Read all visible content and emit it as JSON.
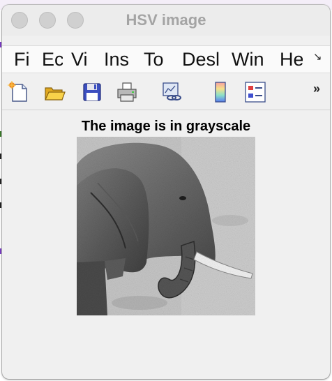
{
  "window": {
    "title": "HSV image"
  },
  "menu": {
    "items": [
      "Fi",
      "Ec",
      "Vi",
      "Ins",
      "To",
      "Desl",
      "Win",
      "He"
    ],
    "overflow_icon": "chevron-overflow-icon"
  },
  "toolbar": {
    "buttons": [
      {
        "name": "new-figure-button",
        "icon": "new-document-icon"
      },
      {
        "name": "open-file-button",
        "icon": "folder-open-icon"
      },
      {
        "name": "save-button",
        "icon": "floppy-disk-icon"
      },
      {
        "name": "print-button",
        "icon": "printer-icon"
      },
      {
        "name": "link-plot-button",
        "icon": "link-plot-icon"
      },
      {
        "name": "insert-colorbar-button",
        "icon": "colorbar-icon"
      },
      {
        "name": "insert-legend-button",
        "icon": "legend-icon"
      }
    ],
    "more_icon": "double-chevron-right-icon"
  },
  "axes": {
    "title": "The image is in grayscale"
  },
  "image": {
    "subject": "elephant-grayscale-image"
  },
  "colors": {
    "window_bg": "#f0f0f0",
    "title_text": "#a4a4a4",
    "menubar_bg": "#fafafa",
    "traffic_light": "#d0d0d0"
  }
}
